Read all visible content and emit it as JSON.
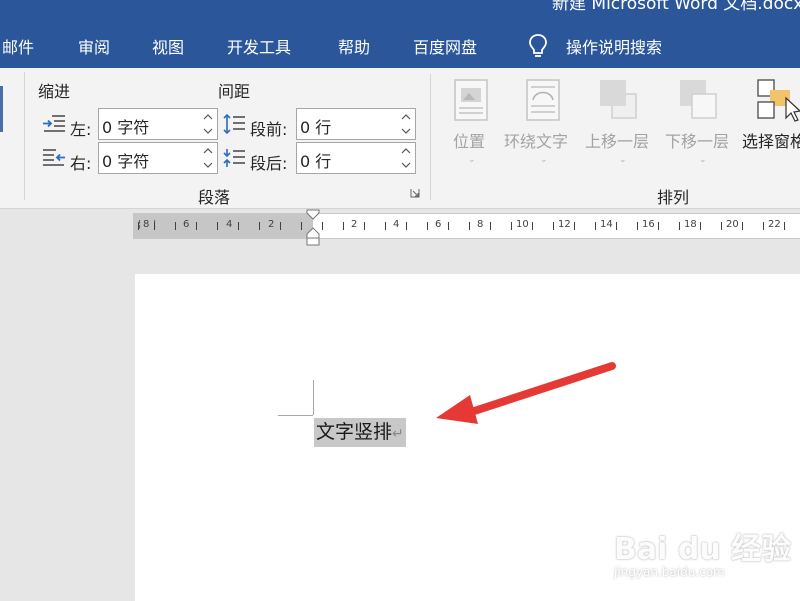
{
  "window": {
    "title": "新建 Microsoft Word 文档.docx"
  },
  "tabs": [
    {
      "label": "邮件"
    },
    {
      "label": "审阅"
    },
    {
      "label": "视图"
    },
    {
      "label": "开发工具"
    },
    {
      "label": "帮助"
    },
    {
      "label": "百度网盘"
    }
  ],
  "tell_me": {
    "label": "操作说明搜索",
    "icon": "lightbulb-icon"
  },
  "paragraph_group": {
    "indent_title": "缩进",
    "spacing_title": "间距",
    "left_label": "左:",
    "right_label": "右:",
    "left_value": "0 字符",
    "right_value": "0 字符",
    "before_label": "段前:",
    "after_label": "段后:",
    "before_value": "0 行",
    "after_value": "0 行",
    "group_name": "段落"
  },
  "arrange_group": {
    "position_label": "位置",
    "wrap_label": "环绕文字",
    "forward_label": "上移一层",
    "backward_label": "下移一层",
    "pane_label": "选择窗格",
    "group_name": "排列"
  },
  "ruler": {
    "labels": [
      "8",
      "6",
      "4",
      "2",
      "2",
      "4",
      "6",
      "8",
      "10",
      "12",
      "14",
      "16",
      "18",
      "20",
      "22"
    ]
  },
  "document": {
    "text": "文字竖排",
    "paragraph_mark": "↵"
  },
  "watermark": {
    "brand": "Bai du 经验",
    "url": "jingyan.baidu.com"
  },
  "colors": {
    "title_bar": "#2b579a",
    "ribbon": "#f3f3f3",
    "selection": "#c8c8c8",
    "annotation_arrow": "#e53935"
  }
}
